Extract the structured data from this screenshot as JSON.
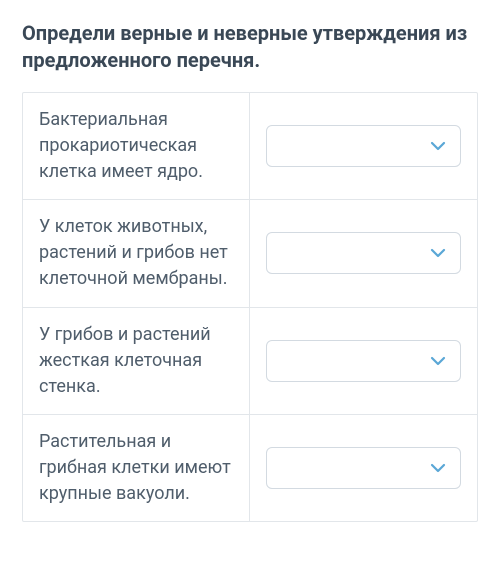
{
  "question": {
    "title": "Определи верные и неверные утверждения из предложенного перечня."
  },
  "statements": [
    {
      "text": "Бактериальная прокариотическая клетка имеет ядро.",
      "selected": ""
    },
    {
      "text": "У клеток животных, растений и грибов нет клеточной мембраны.",
      "selected": ""
    },
    {
      "text": "У грибов и растений жесткая клеточная стенка.",
      "selected": ""
    },
    {
      "text": "Растительная и грибная клетки имеют крупные вакуоли.",
      "selected": ""
    }
  ],
  "colors": {
    "chevron": "#5aa7d6"
  }
}
